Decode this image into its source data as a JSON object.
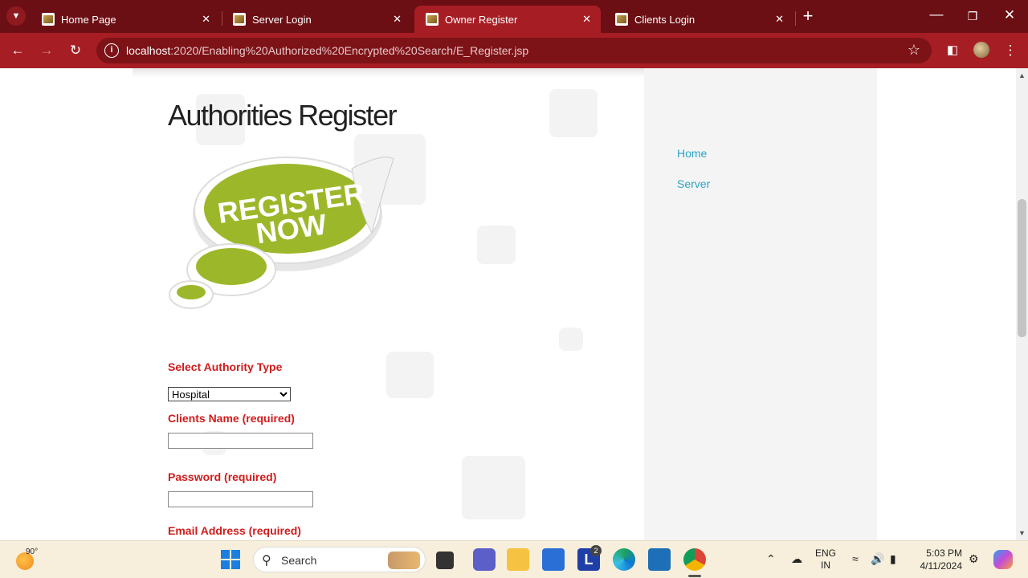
{
  "browser": {
    "tabs": [
      {
        "label": "Home Page",
        "active": false
      },
      {
        "label": "Server Login",
        "active": false
      },
      {
        "label": "Owner Register",
        "active": true
      },
      {
        "label": "Clients Login",
        "active": false
      }
    ],
    "url_host": "localhost",
    "url_path": ":2020/Enabling%20Authorized%20Encrypted%20Search/E_Register.jsp"
  },
  "page": {
    "heading": "Authorities Register",
    "banner_text_line1": "REGISTER",
    "banner_text_line2": "NOW",
    "nav": [
      {
        "label": "Home"
      },
      {
        "label": "Server"
      }
    ],
    "form": {
      "authority_type_label": "Select Authority Type",
      "authority_type_value": "Hospital",
      "clients_name_label": "Clients Name (required)",
      "clients_name_value": "",
      "password_label": "Password (required)",
      "password_value": "",
      "email_label": "Email Address (required)"
    }
  },
  "taskbar": {
    "weather_temp": "90°",
    "search_placeholder": "Search",
    "lang_line1": "ENG",
    "lang_line2": "IN",
    "time": "5:03 PM",
    "date": "4/11/2024",
    "mail_badge": "2"
  },
  "colors": {
    "tabbar_bg": "#6b0f14",
    "toolbar_bg": "#a71d24",
    "label_red": "#d11c1c",
    "link_blue": "#2aa5c6",
    "banner_green": "#9cb82a"
  }
}
